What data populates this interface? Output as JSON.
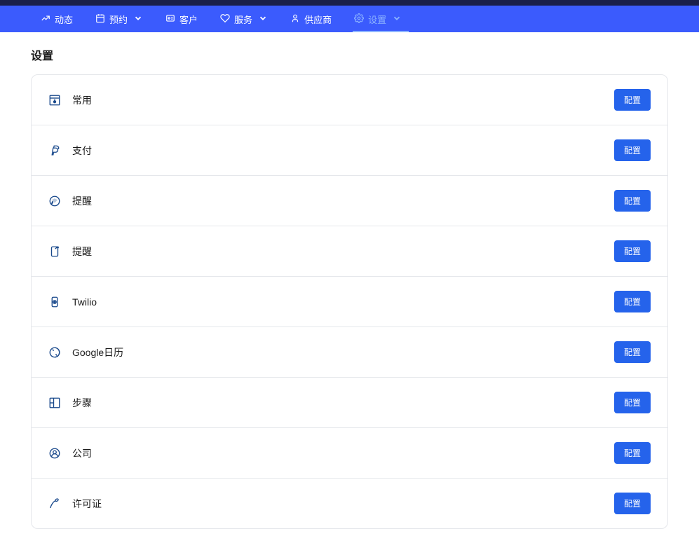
{
  "nav": {
    "items": [
      {
        "label": "动态",
        "icon": "activity",
        "hasDropdown": false,
        "active": false
      },
      {
        "label": "预约",
        "icon": "calendar",
        "hasDropdown": true,
        "active": false
      },
      {
        "label": "客户",
        "icon": "users",
        "hasDropdown": false,
        "active": false
      },
      {
        "label": "服务",
        "icon": "heart",
        "hasDropdown": true,
        "active": false
      },
      {
        "label": "供应商",
        "icon": "user",
        "hasDropdown": false,
        "active": false
      },
      {
        "label": "设置",
        "icon": "gear",
        "hasDropdown": true,
        "active": true
      }
    ]
  },
  "page": {
    "title": "设置",
    "config_button_label": "配置"
  },
  "settings": {
    "items": [
      {
        "label": "常用",
        "icon": "general"
      },
      {
        "label": "支付",
        "icon": "paypal"
      },
      {
        "label": "提醒",
        "icon": "reminder-chat"
      },
      {
        "label": "提醒",
        "icon": "reminder-phone"
      },
      {
        "label": "Twilio",
        "icon": "twilio"
      },
      {
        "label": "Google日历",
        "icon": "google-calendar"
      },
      {
        "label": "步骤",
        "icon": "steps"
      },
      {
        "label": "公司",
        "icon": "company"
      },
      {
        "label": "许可证",
        "icon": "license"
      }
    ]
  }
}
